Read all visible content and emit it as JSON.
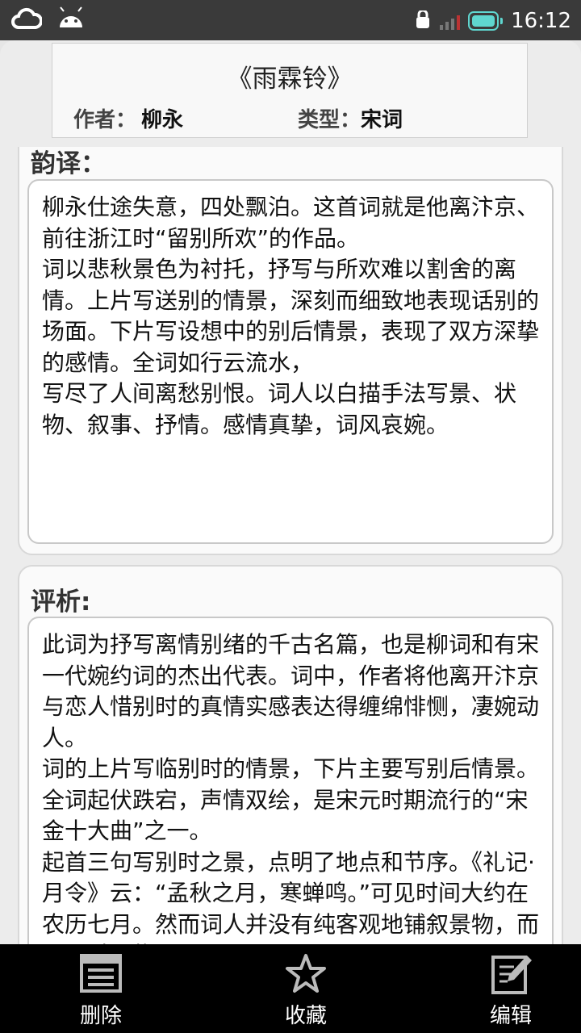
{
  "status": {
    "time": "16:12"
  },
  "poem": {
    "title": "《雨霖铃》",
    "author_label": "作者：",
    "author": "柳永",
    "type_label": "类型：",
    "type": "宋词"
  },
  "translation": {
    "heading": "韵译：",
    "text": "柳永仕途失意，四处飘泊。这首词就是他离汴京、前往浙江时“留别所欢”的作品。\n词以悲秋景色为衬托，抒写与所欢难以割舍的离情。上片写送别的情景，深刻而细致地表现话别的场面。下片写设想中的别后情景，表现了双方深挚的感情。全词如行云流水，\n写尽了人间离愁别恨。词人以白描手法写景、状物、叙事、抒情。感情真挚，词风哀婉。"
  },
  "analysis": {
    "heading": "评析:",
    "text": "此词为抒写离情别绪的千古名篇，也是柳词和有宋一代婉约词的杰出代表。词中，作者将他离开汴京与恋人惜别时的真情实感表达得缠绵悱恻，凄婉动人。\n词的上片写临别时的情景，下片主要写别后情景。全词起伏跌宕，声情双绘，是宋元时期流行的“宋金十大曲”之一。\n起首三句写别时之景，点明了地点和节序。《礼记·月令》云：“孟秋之月，寒蝉鸣。”可见时间大约在农历七月。然而词人并没有纯客观地铺叙景物，而是通过景物"
  },
  "bottom_nav": {
    "delete": "删除",
    "favorite": "收藏",
    "edit": "编辑"
  }
}
